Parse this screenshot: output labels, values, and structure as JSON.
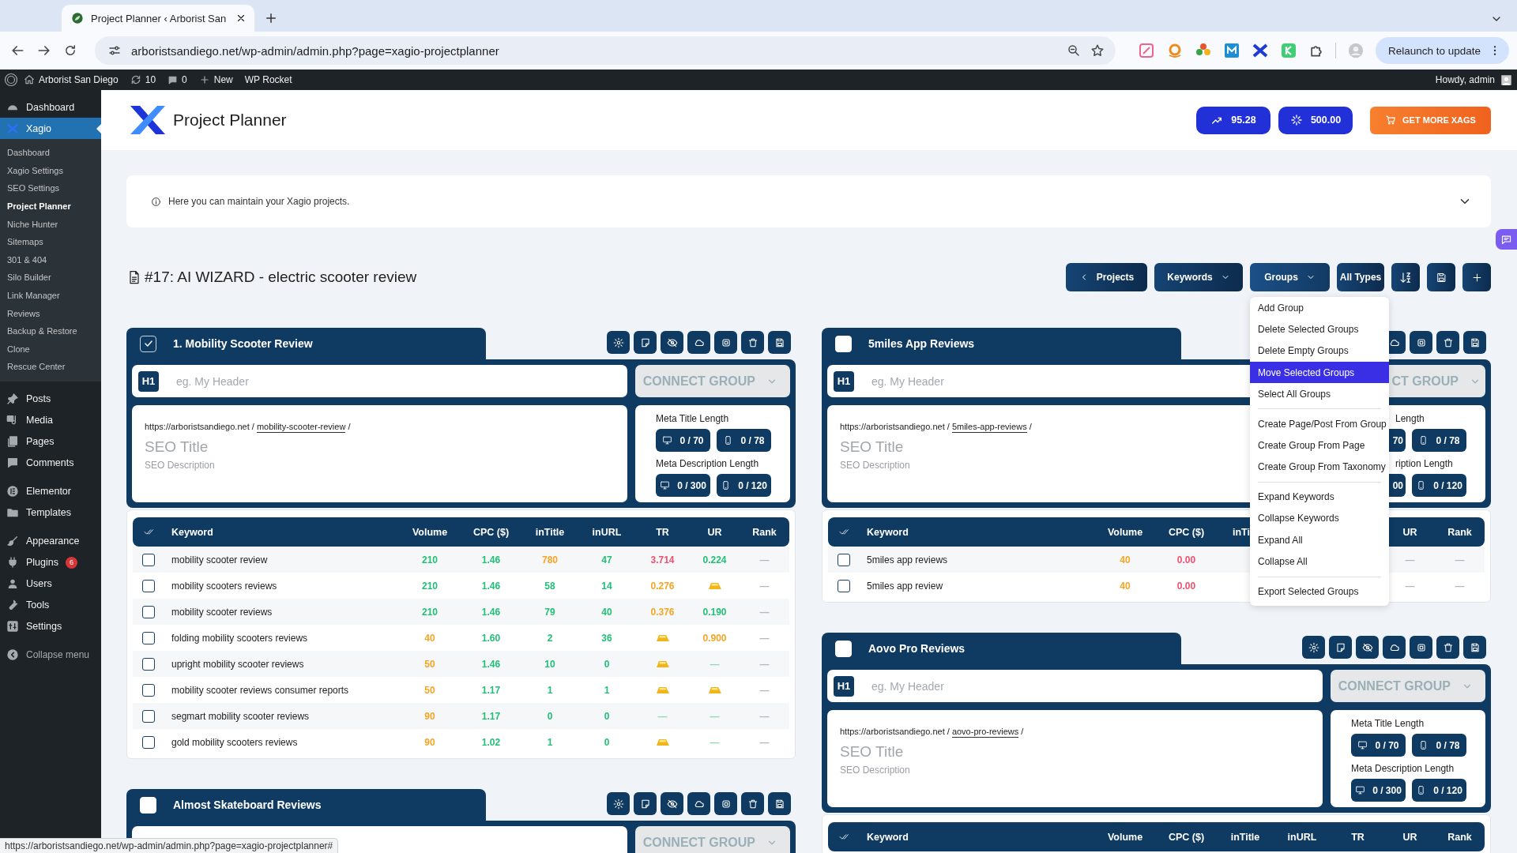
{
  "browser": {
    "tab_title": "Project Planner ‹ Arborist San",
    "url": "arboristsandiego.net/wp-admin/admin.php?page=xagio-projectplanner",
    "update_button": "Relaunch to update"
  },
  "admin_bar": {
    "site": "Arborist San Diego",
    "updates": "10",
    "comments": "0",
    "new": "New",
    "plugin_link": "WP Rocket",
    "greeting": "Howdy, admin"
  },
  "sidebar": {
    "groups": [
      [
        {
          "label": "Dashboard",
          "selected": false
        },
        {
          "label": "Xagio",
          "selected": true,
          "children": [
            {
              "label": "Dashboard",
              "selected": false
            },
            {
              "label": "Xagio Settings",
              "selected": false
            },
            {
              "label": "SEO Settings",
              "selected": false
            },
            {
              "label": "Project Planner",
              "selected": true
            },
            {
              "label": "Niche Hunter",
              "selected": false
            },
            {
              "label": "Sitemaps",
              "selected": false
            },
            {
              "label": "301 & 404",
              "selected": false
            },
            {
              "label": "Silo Builder",
              "selected": false
            },
            {
              "label": "Link Manager",
              "selected": false
            },
            {
              "label": "Reviews",
              "selected": false
            },
            {
              "label": "Backup & Restore",
              "selected": false
            },
            {
              "label": "Clone",
              "selected": false
            },
            {
              "label": "Rescue Center",
              "selected": false
            }
          ]
        }
      ],
      [
        {
          "label": "Posts",
          "selected": false
        },
        {
          "label": "Media",
          "selected": false
        },
        {
          "label": "Pages",
          "selected": false
        },
        {
          "label": "Comments",
          "selected": false
        }
      ],
      [
        {
          "label": "Elementor",
          "selected": false
        },
        {
          "label": "Templates",
          "selected": false
        }
      ],
      [
        {
          "label": "Appearance",
          "selected": false
        },
        {
          "label": "Plugins",
          "selected": false,
          "badge": "6"
        },
        {
          "label": "Users",
          "selected": false
        },
        {
          "label": "Tools",
          "selected": false
        },
        {
          "label": "Settings",
          "selected": false
        }
      ]
    ],
    "collapse": "Collapse menu"
  },
  "header": {
    "title": "Project Planner",
    "credits": [
      "95.28",
      "500.00"
    ],
    "cta": "GET MORE XAGS"
  },
  "notice": {
    "text": "Here you can maintain your Xagio projects."
  },
  "project": {
    "title": "#17: AI WIZARD - electric scooter review",
    "toolbar": [
      {
        "kind": "back",
        "label": "Projects"
      },
      {
        "kind": "dropdown",
        "label": "Keywords",
        "expanded": false
      },
      {
        "kind": "dropdown",
        "label": "Groups",
        "expanded": true,
        "menu": [
          [
            {
              "label": "Add Group",
              "selected": false
            },
            {
              "label": "Delete Selected Groups",
              "selected": false
            },
            {
              "label": "Delete Empty Groups",
              "selected": false
            },
            {
              "label": "Move Selected Groups",
              "selected": true
            },
            {
              "label": "Select All Groups",
              "selected": false
            }
          ],
          [
            {
              "label": "Create Page/Post From Group",
              "selected": false
            },
            {
              "label": "Create Group From Page",
              "selected": false
            },
            {
              "label": "Create Group From Taxonomy",
              "selected": false
            }
          ],
          [
            {
              "label": "Expand Keywords",
              "selected": false
            },
            {
              "label": "Collapse Keywords",
              "selected": false
            },
            {
              "label": "Expand All",
              "selected": false
            },
            {
              "label": "Collapse All",
              "selected": false
            }
          ],
          [
            {
              "label": "Export Selected Groups",
              "selected": false
            }
          ]
        ]
      },
      {
        "kind": "plain",
        "label": "All Types"
      },
      {
        "kind": "sort"
      },
      {
        "kind": "save"
      },
      {
        "kind": "add"
      }
    ]
  },
  "columns": [
    {
      "groups": [
        {
          "title": "1. Mobility Scooter Review",
          "checked": true,
          "h1": {
            "badge": "H1",
            "placeholder": "eg. My Header"
          },
          "connect": "CONNECT GROUP",
          "url": {
            "base": "https://arboristsandiego.net",
            "sep": "/",
            "slug": "mobility-scooter-review"
          },
          "seo_title": "SEO Title",
          "seo_description": "SEO Description",
          "meta": {
            "title_label": "Meta Title Length",
            "title_counts": [
              "0 / 70",
              "0 / 78"
            ],
            "desc_label": "Meta Description Length",
            "desc_counts": [
              "0 / 300",
              "0 / 120"
            ]
          },
          "table": {
            "header": {
              "keyword": "Keyword",
              "volume": "Volume",
              "cpc": "CPC ($)",
              "intitle": "inTitle",
              "inurl": "inURL",
              "tr": "TR",
              "ur": "UR",
              "rank": "Rank"
            },
            "rows": [
              {
                "checked": false,
                "keyword": "mobility scooter review",
                "volume": {
                  "text": "210",
                  "color": "#22bf78"
                },
                "cpc": {
                  "text": "1.46",
                  "color": "#22bf78"
                },
                "intitle": {
                  "text": "780",
                  "color": "#f5a524"
                },
                "inurl": {
                  "text": "47",
                  "color": "#22bf78"
                },
                "tr": {
                  "text": "3.714",
                  "color": "#f0506e"
                },
                "ur": {
                  "text": "0.224",
                  "color": "#22bf78"
                },
                "rank": {
                  "text": "—",
                  "color": "#b4b9bf"
                }
              },
              {
                "checked": false,
                "keyword": "mobility scooters reviews",
                "volume": {
                  "text": "210",
                  "color": "#22bf78"
                },
                "cpc": {
                  "text": "1.46",
                  "color": "#22bf78"
                },
                "intitle": {
                  "text": "58",
                  "color": "#22bf78"
                },
                "inurl": {
                  "text": "14",
                  "color": "#22bf78"
                },
                "tr": {
                  "text": "0.276",
                  "color": "#f5a524"
                },
                "ur": {
                  "kind": "gold"
                },
                "rank": {
                  "text": "—",
                  "color": "#b4b9bf"
                }
              },
              {
                "checked": false,
                "keyword": "mobility scooter reviews",
                "volume": {
                  "text": "210",
                  "color": "#22bf78"
                },
                "cpc": {
                  "text": "1.46",
                  "color": "#22bf78"
                },
                "intitle": {
                  "text": "79",
                  "color": "#22bf78"
                },
                "inurl": {
                  "text": "40",
                  "color": "#22bf78"
                },
                "tr": {
                  "text": "0.376",
                  "color": "#f5a524"
                },
                "ur": {
                  "text": "0.190",
                  "color": "#22bf78"
                },
                "rank": {
                  "text": "—",
                  "color": "#b4b9bf"
                }
              },
              {
                "checked": false,
                "keyword": "folding mobility scooters reviews",
                "volume": {
                  "text": "40",
                  "color": "#f5a524"
                },
                "cpc": {
                  "text": "1.60",
                  "color": "#22bf78"
                },
                "intitle": {
                  "text": "2",
                  "color": "#22bf78"
                },
                "inurl": {
                  "text": "36",
                  "color": "#22bf78"
                },
                "tr": {
                  "kind": "gold"
                },
                "ur": {
                  "text": "0.900",
                  "color": "#f5a524"
                },
                "rank": {
                  "text": "—",
                  "color": "#b4b9bf"
                }
              },
              {
                "checked": false,
                "keyword": "upright mobility scooter reviews",
                "volume": {
                  "text": "50",
                  "color": "#f5a524"
                },
                "cpc": {
                  "text": "1.46",
                  "color": "#22bf78"
                },
                "intitle": {
                  "text": "10",
                  "color": "#22bf78"
                },
                "inurl": {
                  "text": "0",
                  "color": "#22bf78"
                },
                "tr": {
                  "kind": "gold"
                },
                "ur": {
                  "text": "—",
                  "color": "#8fd9b4"
                },
                "rank": {
                  "text": "—",
                  "color": "#b4b9bf"
                }
              },
              {
                "checked": false,
                "keyword": "mobility scooter reviews consumer reports",
                "volume": {
                  "text": "50",
                  "color": "#f5a524"
                },
                "cpc": {
                  "text": "1.17",
                  "color": "#22bf78"
                },
                "intitle": {
                  "text": "1",
                  "color": "#22bf78"
                },
                "inurl": {
                  "text": "1",
                  "color": "#22bf78"
                },
                "tr": {
                  "kind": "gold"
                },
                "ur": {
                  "kind": "gold"
                },
                "rank": {
                  "text": "—",
                  "color": "#b4b9bf"
                }
              },
              {
                "checked": false,
                "keyword": "segmart mobility scooter reviews",
                "volume": {
                  "text": "90",
                  "color": "#f5a524"
                },
                "cpc": {
                  "text": "1.17",
                  "color": "#22bf78"
                },
                "intitle": {
                  "text": "0",
                  "color": "#22bf78"
                },
                "inurl": {
                  "text": "0",
                  "color": "#22bf78"
                },
                "tr": {
                  "text": "—",
                  "color": "#8fd9b4"
                },
                "ur": {
                  "text": "—",
                  "color": "#8fd9b4"
                },
                "rank": {
                  "text": "—",
                  "color": "#b4b9bf"
                }
              },
              {
                "checked": false,
                "keyword": "gold mobility scooters reviews",
                "volume": {
                  "text": "90",
                  "color": "#f5a524"
                },
                "cpc": {
                  "text": "1.02",
                  "color": "#22bf78"
                },
                "intitle": {
                  "text": "1",
                  "color": "#22bf78"
                },
                "inurl": {
                  "text": "0",
                  "color": "#22bf78"
                },
                "tr": {
                  "kind": "gold"
                },
                "ur": {
                  "text": "—",
                  "color": "#8fd9b4"
                },
                "rank": {
                  "text": "—",
                  "color": "#b4b9bf"
                }
              }
            ]
          }
        },
        {
          "title": "Almost Skateboard Reviews",
          "checked": false,
          "connect": "CONNECT GROUP"
        }
      ]
    },
    {
      "groups": [
        {
          "title": "5miles App Reviews",
          "checked": false,
          "under_menu": true,
          "h1": {
            "badge": "H1",
            "placeholder": "eg. My Header"
          },
          "connect": "CT GROUP",
          "url": {
            "base": "https://arboristsandiego.net",
            "sep": "/",
            "slug": "5miles-app-reviews"
          },
          "seo_title": "SEO Title",
          "seo_description": "SEO Description",
          "meta": {
            "title_label": "Length",
            "title_counts": [
              "70",
              "0 / 78"
            ],
            "desc_label": "ription Length",
            "desc_counts": [
              "00",
              "0 / 120"
            ]
          },
          "table": {
            "header": {
              "keyword": "Keyword",
              "volume": "Volume",
              "cpc": "CPC ($)",
              "intitle": "inTi",
              "ur": "UR",
              "rank": "Rank"
            },
            "rows": [
              {
                "checked": false,
                "keyword": "5miles app reviews",
                "volume": {
                  "text": "40",
                  "color": "#f5a524"
                },
                "cpc": {
                  "text": "0.00",
                  "color": "#f0506e"
                },
                "ur": {
                  "text": "—",
                  "color": "#b4b9bf"
                },
                "rank": {
                  "text": "—",
                  "color": "#b4b9bf"
                }
              },
              {
                "checked": false,
                "keyword": "5miles app review",
                "volume": {
                  "text": "40",
                  "color": "#f5a524"
                },
                "cpc": {
                  "text": "0.00",
                  "color": "#f0506e"
                },
                "ur": {
                  "text": "—",
                  "color": "#b4b9bf"
                },
                "rank": {
                  "text": "—",
                  "color": "#b4b9bf"
                }
              }
            ]
          }
        },
        {
          "title": "Aovo Pro Reviews",
          "checked": false,
          "h1": {
            "badge": "H1",
            "placeholder": "eg. My Header"
          },
          "connect": "CONNECT GROUP",
          "url": {
            "base": "https://arboristsandiego.net",
            "sep": "/",
            "slug": "aovo-pro-reviews"
          },
          "seo_title": "SEO Title",
          "seo_description": "SEO Description",
          "meta": {
            "title_label": "Meta Title Length",
            "title_counts": [
              "0 / 70",
              "0 / 78"
            ],
            "desc_label": "Meta Description Length",
            "desc_counts": [
              "0 / 300",
              "0 / 120"
            ]
          },
          "table": {
            "header": {
              "keyword": "Keyword",
              "volume": "Volume",
              "cpc": "CPC ($)",
              "intitle": "inTitle",
              "inurl": "inURL",
              "tr": "TR",
              "ur": "UR",
              "rank": "Rank"
            }
          }
        }
      ]
    }
  ],
  "status_url": "https://arboristsandiego.net/wp-admin/admin.php?page=xagio-projectplanner#"
}
